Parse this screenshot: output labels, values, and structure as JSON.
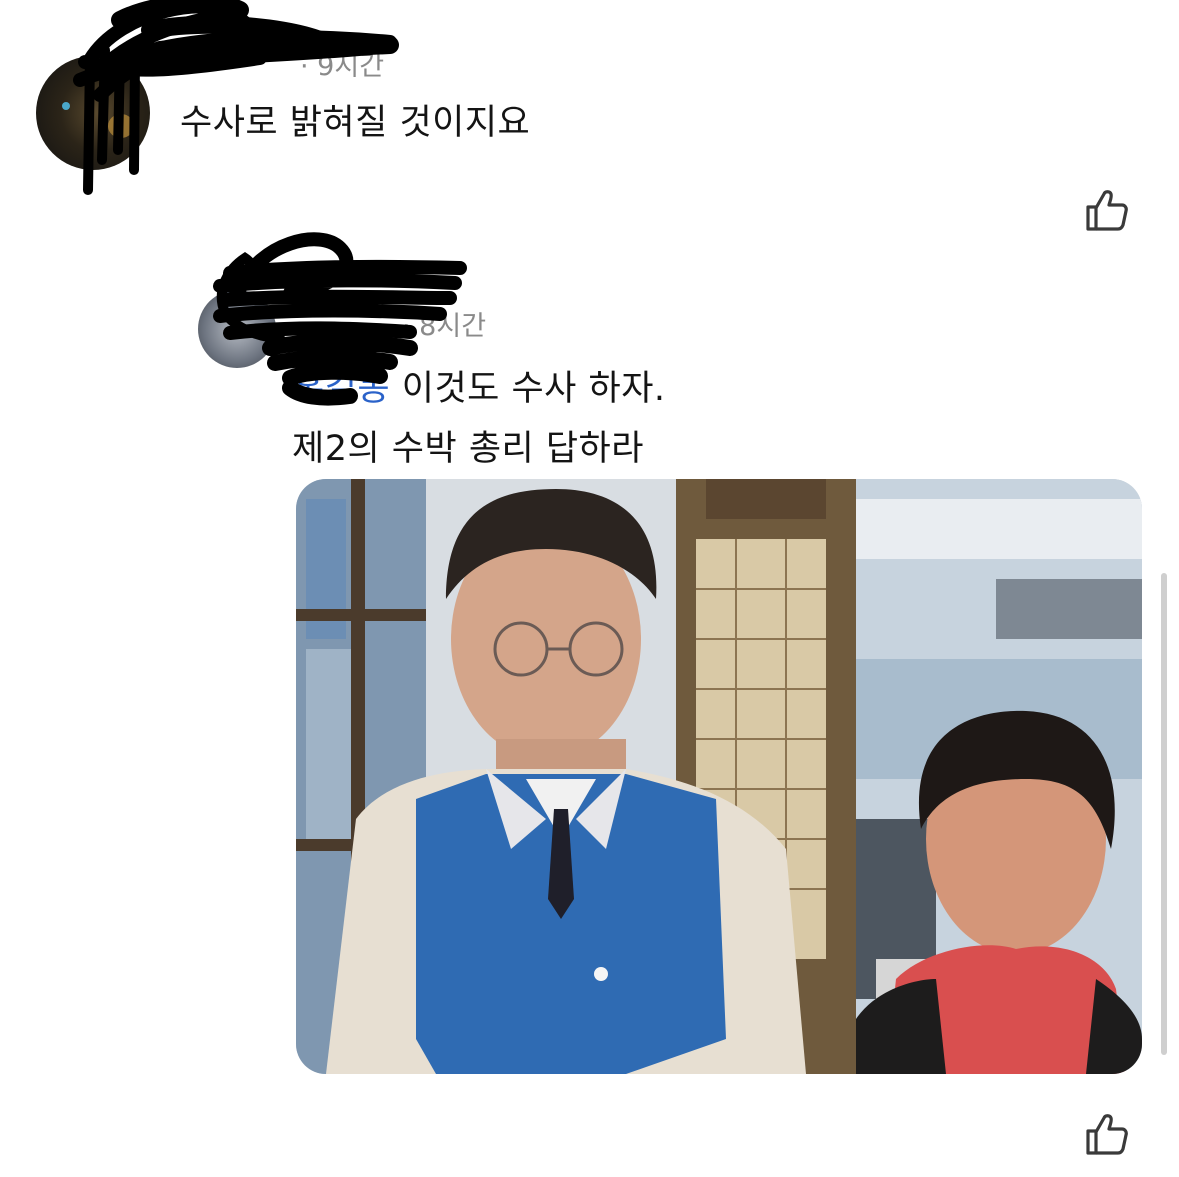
{
  "comments": [
    {
      "time": "9시간",
      "text": "수사로 밝혀질 것이지요"
    },
    {
      "time": "8시간",
      "mention": "홍길동",
      "line1": "이것도 수사 하자.",
      "line2": "제2의 수박 총리 답하라"
    }
  ],
  "icons": {
    "like": "thumbs-up-icon"
  },
  "colors": {
    "mention": "#2a62c9",
    "meta": "#8a8a8a",
    "jacket": "#2f6bb3"
  }
}
